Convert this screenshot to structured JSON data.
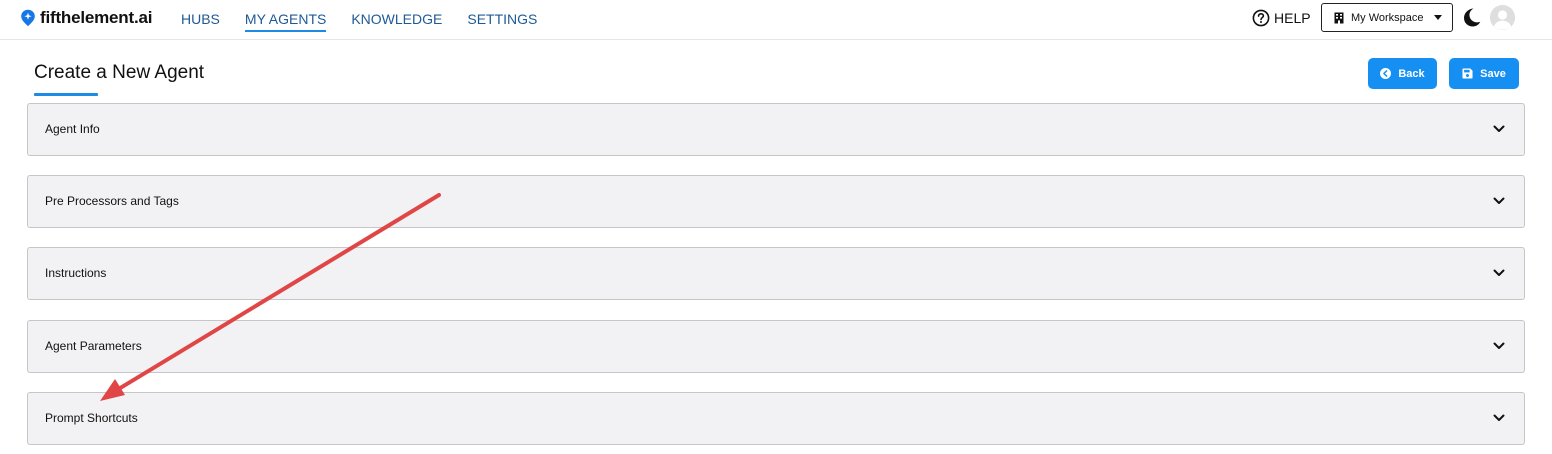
{
  "brand": {
    "name": "fifthelement.ai",
    "icon": "location-pin-icon"
  },
  "nav": {
    "items": [
      {
        "label": "HUBS"
      },
      {
        "label": "MY AGENTS",
        "active": true
      },
      {
        "label": "KNOWLEDGE"
      },
      {
        "label": "SETTINGS"
      }
    ]
  },
  "header_right": {
    "help_label": "HELP",
    "help_icon": "question-circle-icon",
    "workspace_label": "My Workspace",
    "workspace_icon": "building-icon",
    "theme_icon": "moon-icon",
    "avatar_icon": "user-avatar-icon"
  },
  "page": {
    "title": "Create a New Agent",
    "back_label": "Back",
    "back_icon": "arrow-left-circle-icon",
    "save_label": "Save",
    "save_icon": "floppy-disk-icon"
  },
  "sections": [
    {
      "label": "Agent Info"
    },
    {
      "label": "Pre Processors and Tags"
    },
    {
      "label": "Instructions"
    },
    {
      "label": "Agent Parameters"
    },
    {
      "label": "Prompt Shortcuts"
    }
  ],
  "annotation": {
    "color": "#e04646",
    "target": "Prompt Shortcuts"
  },
  "colors": {
    "accent": "#1590f2",
    "nav_link": "#1f5a96",
    "panel_bg": "#f2f2f4",
    "panel_border": "#c6c6c8"
  }
}
